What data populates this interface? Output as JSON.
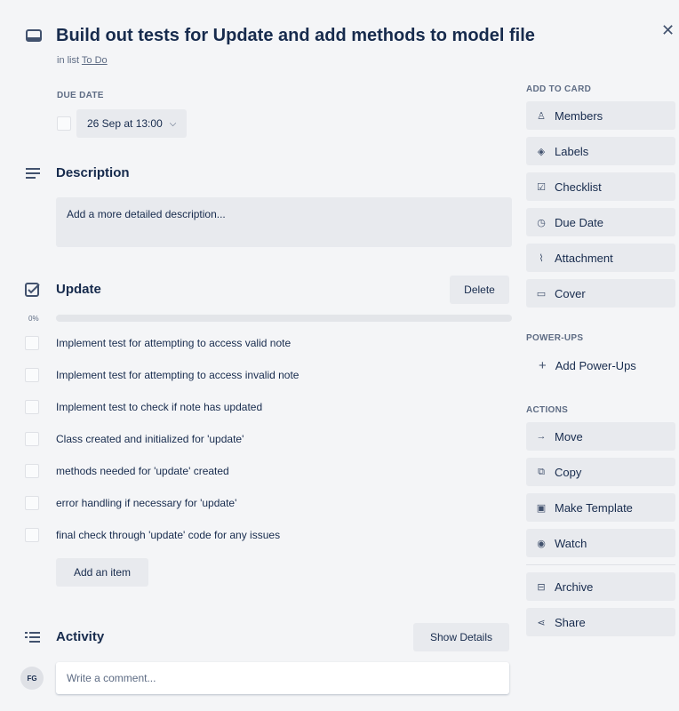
{
  "card": {
    "title": "Build out tests for Update and add methods to model file",
    "in_list_prefix": "in list",
    "list_name": "To Do",
    "close_icon": "close-icon"
  },
  "due_date": {
    "label": "DUE DATE",
    "value": "26 Sep at 13:00",
    "checked": false
  },
  "description": {
    "title": "Description",
    "placeholder": "Add a more detailed description..."
  },
  "checklist": {
    "title": "Update",
    "delete_label": "Delete",
    "progress_label": "0%",
    "progress": 0,
    "items": [
      {
        "text": "Implement test for attempting to access valid note",
        "checked": false
      },
      {
        "text": "Implement test for attempting to access invalid note",
        "checked": false
      },
      {
        "text": "Implement test to check if note has updated",
        "checked": false
      },
      {
        "text": "Class created and initialized for 'update'",
        "checked": false
      },
      {
        "text": "methods needed for 'update' created",
        "checked": false
      },
      {
        "text": "error handling if necessary for 'update'",
        "checked": false
      },
      {
        "text": "final check through 'update' code for any issues",
        "checked": false
      }
    ],
    "add_item_label": "Add an item"
  },
  "activity": {
    "title": "Activity",
    "show_details_label": "Show Details",
    "avatar_initials": "FG",
    "comment_placeholder": "Write a comment..."
  },
  "sidebar": {
    "add_to_card_label": "ADD TO CARD",
    "add_to_card": [
      {
        "label": "Members",
        "icon": "person-icon"
      },
      {
        "label": "Labels",
        "icon": "tag-icon"
      },
      {
        "label": "Checklist",
        "icon": "checklist-icon"
      },
      {
        "label": "Due Date",
        "icon": "clock-icon"
      },
      {
        "label": "Attachment",
        "icon": "paperclip-icon"
      },
      {
        "label": "Cover",
        "icon": "cover-icon"
      }
    ],
    "power_ups_label": "POWER-UPS",
    "add_power_ups_label": "Add Power-Ups",
    "actions_label": "ACTIONS",
    "actions": [
      {
        "label": "Move",
        "icon": "arrow-right-icon"
      },
      {
        "label": "Copy",
        "icon": "copy-icon"
      },
      {
        "label": "Make Template",
        "icon": "template-icon"
      },
      {
        "label": "Watch",
        "icon": "eye-icon"
      }
    ],
    "secondary_actions": [
      {
        "label": "Archive",
        "icon": "archive-icon"
      },
      {
        "label": "Share",
        "icon": "share-icon"
      }
    ]
  },
  "colors": {
    "background": "#f4f5f7",
    "button": "#e8eaee",
    "text": "#172b4d",
    "muted": "#5e6c84",
    "progress": "#5ba4cf"
  }
}
